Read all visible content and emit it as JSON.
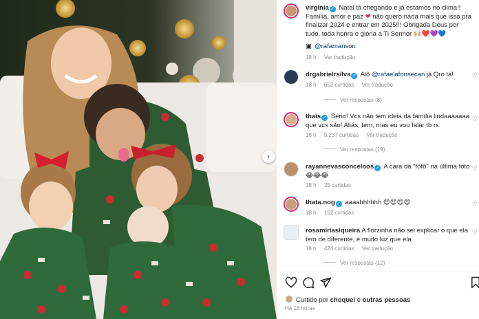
{
  "post": {
    "author": "virginia",
    "caption_text": "Natal tá chegando e já estamos no clima!! Família, amor e paz",
    "caption_text_2": "não quero nada mais que isso pra finalizar 2024 e entrar em 2025!!! Obrigada Deus por tudo, toda honra e glória a Ti Senhor",
    "caption_emojis": "🙌🏼❤️💜💙",
    "photographer_link": "@rafamanson",
    "photographer_icon": "camera-icon",
    "age": "18 h",
    "see_translation": "Ver tradução"
  },
  "comments": [
    {
      "username": "drgabrielrsilva",
      "verified": true,
      "pre_text": "Alô",
      "mention": "@rafaelafonsecan",
      "text": "já Qro tá!",
      "age": "18 h",
      "likes": "653 curtidas",
      "translate": "Ver tradução",
      "replies": "Ver respostas (8)"
    },
    {
      "username": "thais",
      "verified": true,
      "text": "Sério! Vcs não tem ideia da família lindaaaaaaa que vcs são! Aliás, tem, mas eu vou falar tb rs",
      "age": "18 h",
      "likes": "5.237 curtidas",
      "translate": "Ver tradução",
      "replies": "Ver respostas (19)"
    },
    {
      "username": "rayannevasconceloos",
      "verified": true,
      "text": "A cara da \"fôfô\" na última foto 😂😂😂",
      "age": "18 h",
      "likes": "35 curtidas"
    },
    {
      "username": "thata.nog",
      "verified": true,
      "text": "aaaahhhhhh 😍😍😍😍",
      "age": "18 h",
      "likes": "152 curtidas"
    },
    {
      "username": "rosamiriasiqueira",
      "verified": false,
      "text": "A florzinha não sei explicar o que ela tem de diferente, é muito luz que ela",
      "age": "18 h",
      "likes": "424 curtidas",
      "translate": "Ver tradução",
      "replies": "Ver respostas (12)"
    }
  ],
  "footer": {
    "liked_by_prefix": "Curtido por",
    "liked_by_user": "choquei",
    "liked_by_and": "e",
    "liked_by_others": "outras pessoas",
    "timestamp": "Há 18 horas"
  },
  "icons": {
    "like": "heart-outline-icon",
    "comment": "comment-icon",
    "share": "send-icon",
    "save": "bookmark-icon",
    "next": "chevron-right-icon",
    "comment_like": "heart-outline-icon"
  },
  "colors": {
    "verified": "#1d9bf0",
    "link": "#00376b",
    "muted": "#8e8e8e",
    "story_ring": "#d62976"
  }
}
